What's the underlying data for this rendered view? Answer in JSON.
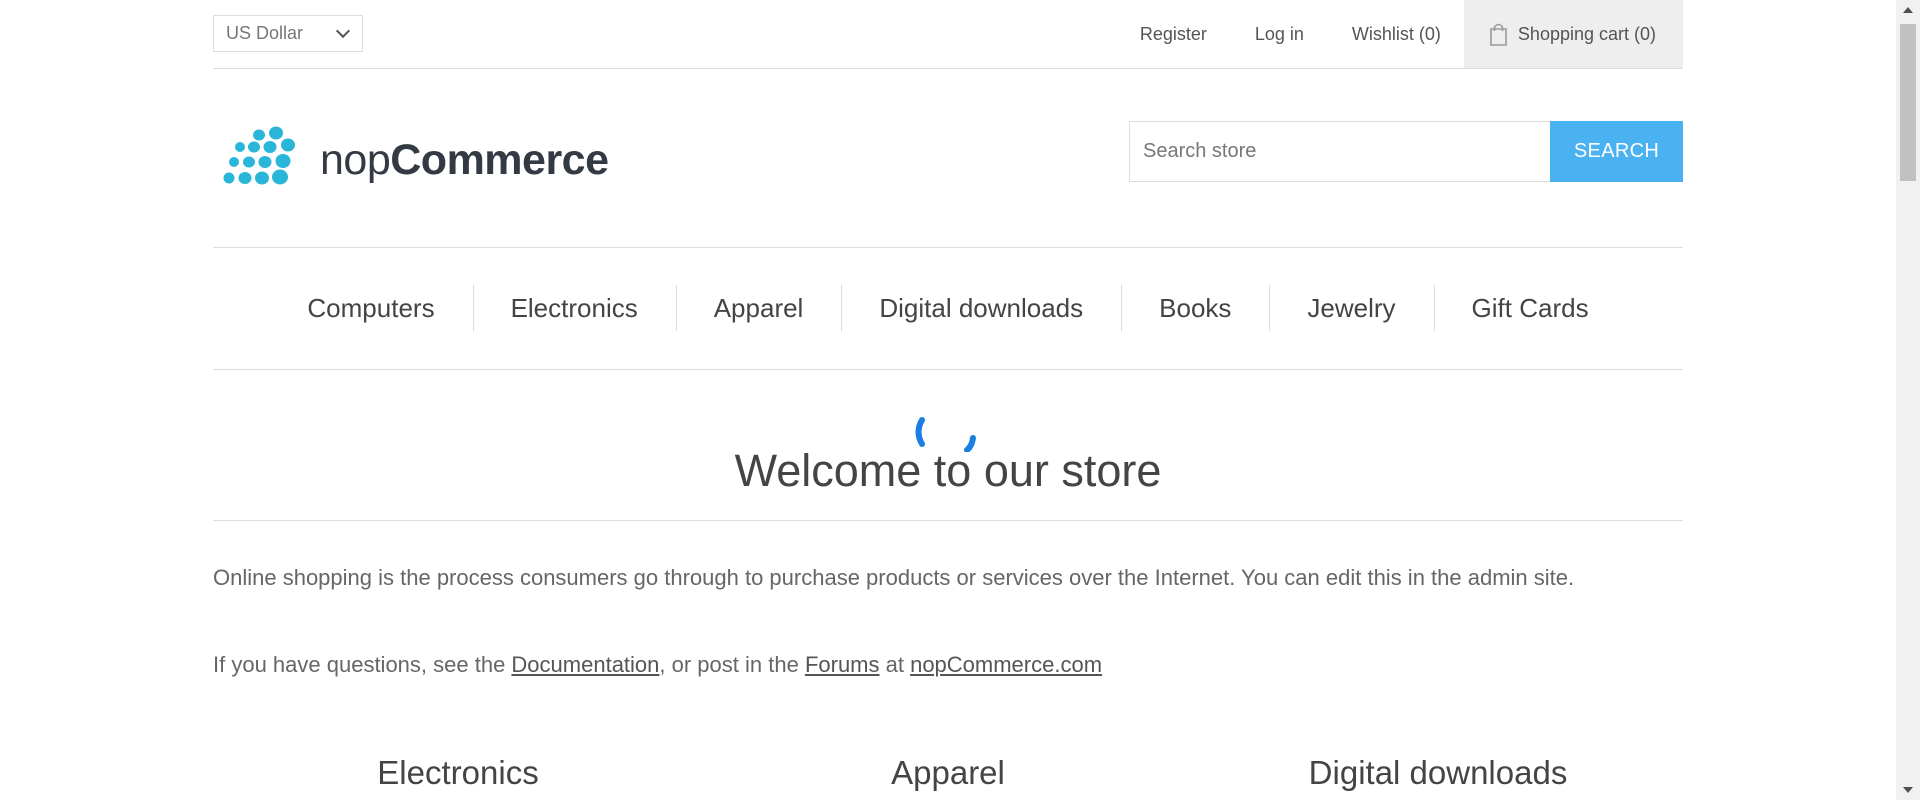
{
  "header": {
    "currency": "US Dollar",
    "links": {
      "register": "Register",
      "login": "Log in",
      "wishlist": "Wishlist (0)",
      "cart": "Shopping cart (0)"
    }
  },
  "logo": {
    "light": "nop",
    "bold": "Commerce",
    "color": "#29b6d9"
  },
  "search": {
    "placeholder": "Search store",
    "button": "SEARCH",
    "button_color": "#4ab2f1"
  },
  "menu": {
    "items": [
      "Computers",
      "Electronics",
      "Apparel",
      "Digital downloads",
      "Books",
      "Jewelry",
      "Gift Cards"
    ]
  },
  "welcome": {
    "title": "Welcome to our store",
    "paragraph1": "Online shopping is the process consumers go through to purchase products or services over the Internet. You can edit this in the admin site.",
    "p2_prefix": "If you have questions, see the ",
    "link_documentation": "Documentation",
    "p2_middle": ", or post in the ",
    "link_forums": "Forums",
    "p2_at": " at ",
    "link_site": "nopCommerce.com"
  },
  "categories": [
    "Electronics",
    "Apparel",
    "Digital downloads"
  ],
  "colors": {
    "spinner": "#1a7fe0",
    "text": "#444444",
    "border": "#dddddd"
  }
}
